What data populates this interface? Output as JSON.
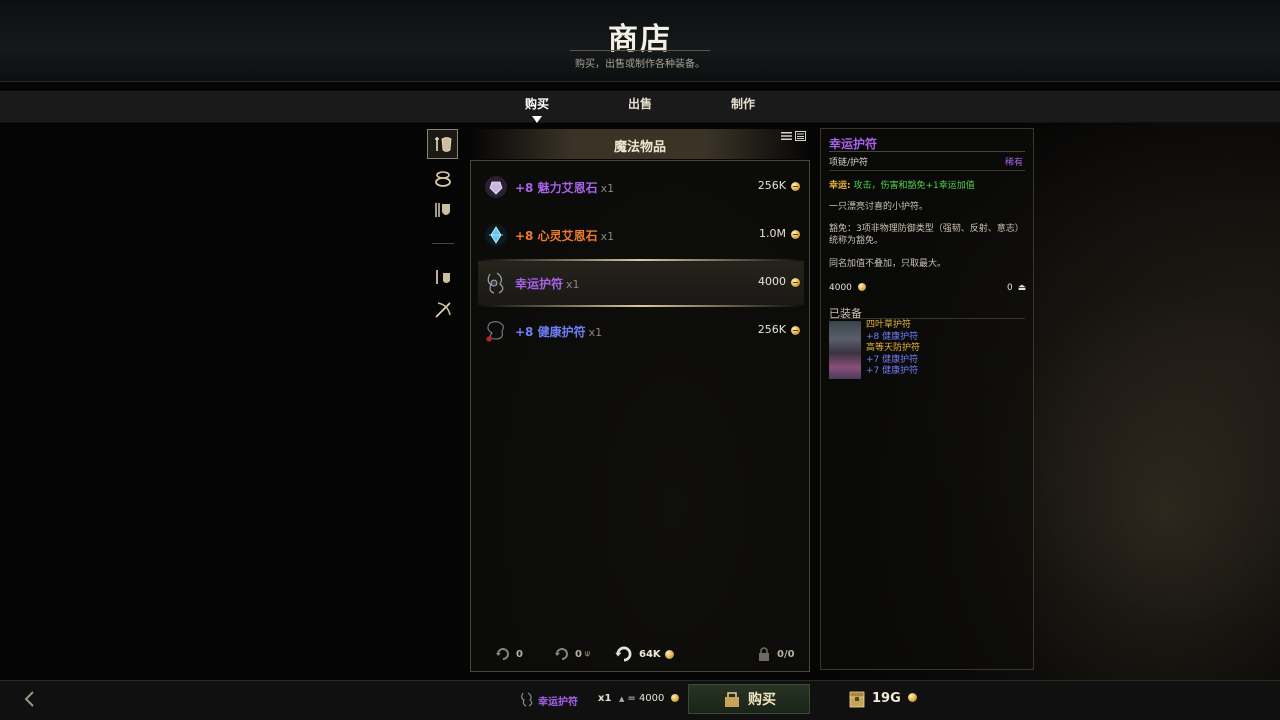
{
  "header": {
    "title": "商店",
    "subtitle": "购买，出售或制作各种装备。"
  },
  "tabs": [
    {
      "label": "购买",
      "active": true
    },
    {
      "label": "出售",
      "active": false
    },
    {
      "label": "制作",
      "active": false
    }
  ],
  "categories": [
    "weapon-armor-icon",
    "ring-icon",
    "armor-icon",
    "potion-icon",
    "bow-icon"
  ],
  "panel": {
    "title": "魔法物品",
    "items": [
      {
        "name": "+8 魅力艾恩石",
        "qty": "x1",
        "price": "256K",
        "color": "#a861e8",
        "icon": "gem-icon"
      },
      {
        "name": "+8 心灵艾恩石",
        "qty": "x1",
        "price": "1.0M",
        "color": "#f07a2c",
        "icon": "crystal-icon"
      },
      {
        "name": "幸运护符",
        "qty": "x1",
        "price": "4000",
        "color": "#a861e8",
        "icon": "amulet-icon",
        "selected": true
      },
      {
        "name": "+8 健康护符",
        "qty": "x1",
        "price": "256K",
        "color": "#6f7df5",
        "icon": "amulet-icon"
      }
    ],
    "footer": {
      "refresh1": "0",
      "refresh2": "0",
      "refresh_cost": "64K",
      "lock": "0/0"
    }
  },
  "detail": {
    "name": "幸运护符",
    "type": "项链/护符",
    "rarity": "稀有",
    "effect_label": "幸运:",
    "effect_text": "攻击，伤害和豁免+1幸运加值",
    "desc1": "一只漂亮讨喜的小护符。",
    "desc2": "豁免：3项非物理防御类型（强韧、反射、意志）统称为豁免。",
    "desc3": "同名加值不叠加，只取最大。",
    "price": "4000",
    "weight": "0",
    "equipped_label": "已装备",
    "equipped": [
      {
        "text": "四叶草护符",
        "color": "#e6b63a"
      },
      {
        "text": "+8 健康护符",
        "color": "#6f7df5"
      },
      {
        "text": "高等天防护符",
        "color": "#e6b63a"
      },
      {
        "text": "+7 健康护符",
        "color": "#6f7df5"
      },
      {
        "text": "+7 健康护符",
        "color": "#6f7df5"
      }
    ]
  },
  "bottom": {
    "item": "幸运护符",
    "qty": "x1",
    "total": "= 4000",
    "buy_label": "购买",
    "gold": "19G"
  }
}
